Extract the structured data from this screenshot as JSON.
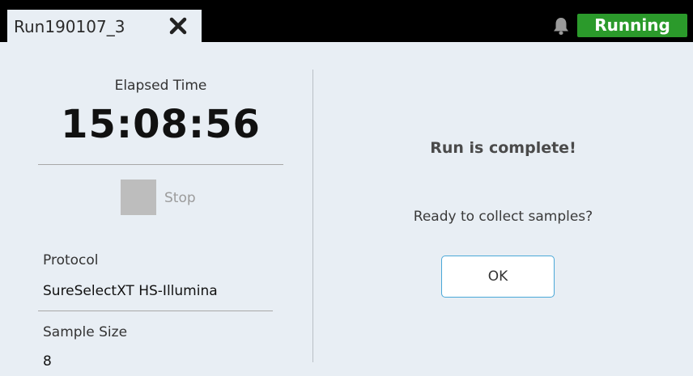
{
  "header": {
    "tab_title": "Run190107_3",
    "tab_close_icon": "close-icon",
    "notification_icon": "bell-icon",
    "status_label": "Running",
    "status_color": "#2b9a2b"
  },
  "left_panel": {
    "elapsed_label": "Elapsed Time",
    "elapsed_value": "15:08:56",
    "stop_label": "Stop",
    "protocol_label": "Protocol",
    "protocol_value": "SureSelectXT HS-Illumina",
    "sample_size_label": "Sample Size",
    "sample_size_value": "8"
  },
  "dialog": {
    "title": "Run is complete!",
    "message": "Ready to collect samples?",
    "ok_label": "OK"
  }
}
